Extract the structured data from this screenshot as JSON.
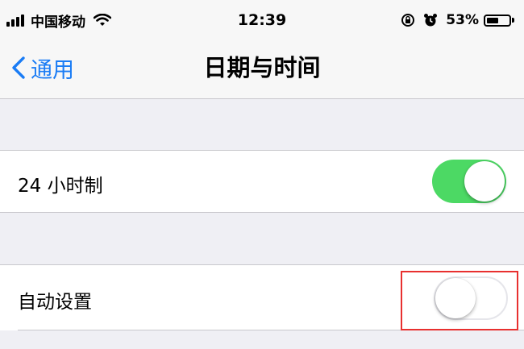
{
  "status_bar": {
    "carrier": "中国移动",
    "time": "12:39",
    "battery_percent": "53%",
    "battery_level": 0.53,
    "icons": [
      "signal-icon",
      "wifi-icon",
      "rotation-lock-icon",
      "alarm-icon",
      "battery-icon"
    ]
  },
  "nav": {
    "back_label": "通用",
    "title": "日期与时间"
  },
  "settings": {
    "hour24": {
      "label": "24 小时制",
      "value": true
    },
    "auto_set": {
      "label": "自动设置",
      "value": false
    }
  },
  "colors": {
    "accent": "#1a7cf5",
    "toggle_on": "#4cd964",
    "highlight": "#e8302f",
    "background": "#efeff4"
  }
}
